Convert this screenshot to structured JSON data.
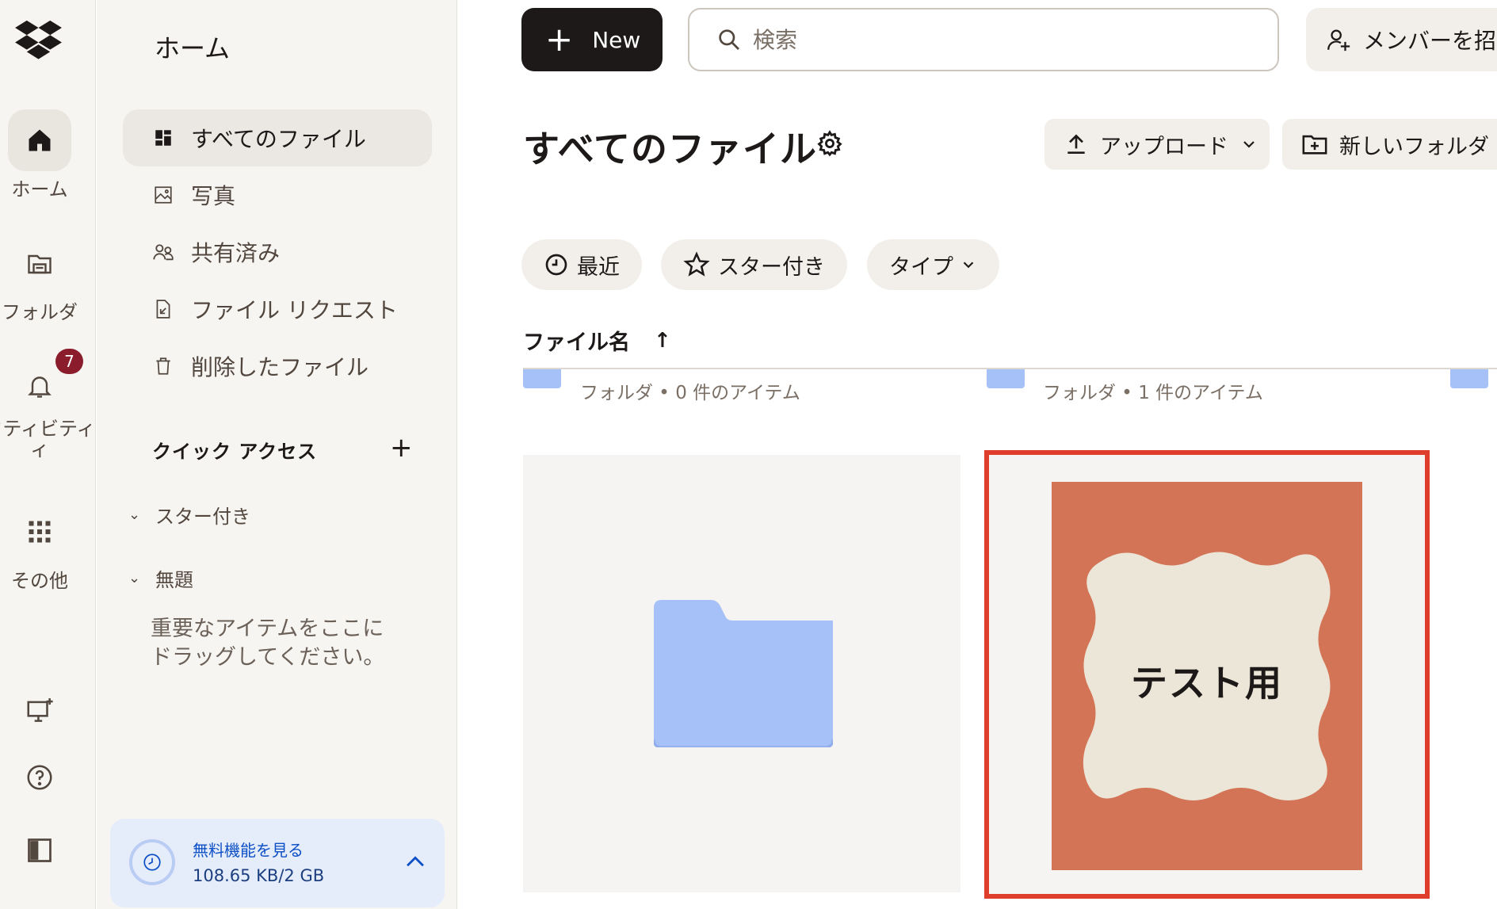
{
  "rail": {
    "items": [
      {
        "label": "ホーム",
        "icon": "home-icon"
      },
      {
        "label": "フォルダ",
        "icon": "folder-icon"
      },
      {
        "label": "クティビティ",
        "label2": "ィ",
        "icon": "bell-icon",
        "badge": "7"
      },
      {
        "label": "その他",
        "icon": "grid-icon"
      }
    ],
    "bottom_icons": [
      "desktop-add-icon",
      "help-icon",
      "panel-icon"
    ]
  },
  "nav": {
    "title": "ホーム",
    "items": [
      {
        "label": "すべてのファイル",
        "icon": "files-icon"
      },
      {
        "label": "写真",
        "icon": "photo-icon"
      },
      {
        "label": "共有済み",
        "icon": "shared-icon"
      },
      {
        "label": "ファイル リクエスト",
        "icon": "file-request-icon"
      },
      {
        "label": "削除したファイル",
        "icon": "trash-icon"
      }
    ],
    "quick_access": {
      "title": "クイック アクセス",
      "tree": [
        "スター付き",
        "無題"
      ],
      "hint": "重要なアイテムをここにドラッグしてください。"
    },
    "storage": {
      "title": "無料機能を見る",
      "usage": "108.65 KB/2 GB"
    }
  },
  "topbar": {
    "new_label": "New",
    "search_placeholder": "検索",
    "invite_label": "メンバーを招"
  },
  "main": {
    "title": "すべてのファイル",
    "upload_label": "アップロード",
    "new_folder_label": "新しいフォルダ",
    "filters": [
      "最近",
      "スター付き",
      "タイプ"
    ],
    "column_header": "ファイル名",
    "rows_meta": [
      "フォルダ • 0 件のアイテム",
      "フォルダ • 1 件のアイテム"
    ],
    "thumbnail_text": "テスト用"
  },
  "colors": {
    "selection": "#e03e2d",
    "folder": "#a6c1f7",
    "thumbnail_bg": "#d37456",
    "badge": "#8a1c2c"
  }
}
